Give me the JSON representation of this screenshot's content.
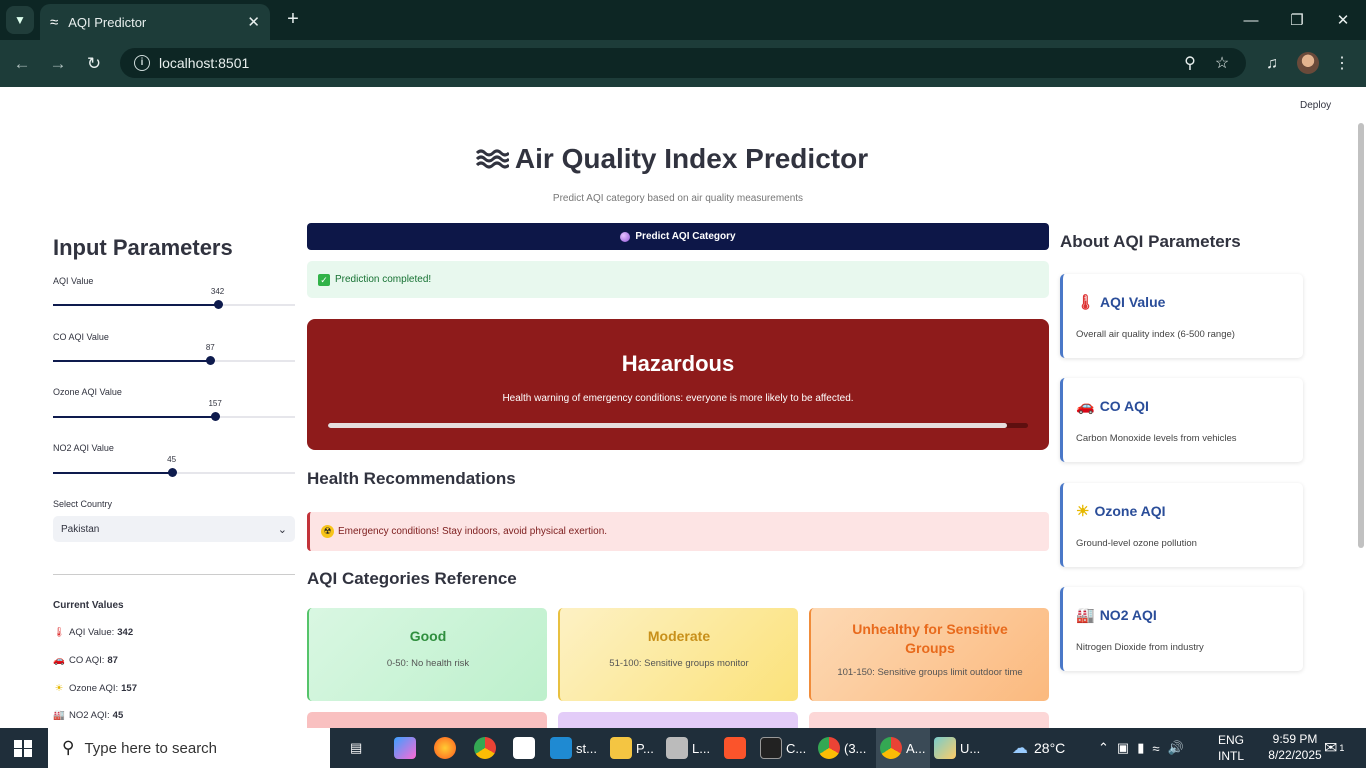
{
  "browser": {
    "tab_title": "AQI Predictor",
    "url": "localhost:8501"
  },
  "app": {
    "deploy_label": "Deploy",
    "title": "Air Quality Index Predictor",
    "title_icon": "wave-icon",
    "subtitle": "Predict AQI category based on air quality measurements"
  },
  "sidebar": {
    "title": "Input Parameters",
    "sliders": [
      {
        "label": "AQI Value",
        "value": "342",
        "fraction": 0.68
      },
      {
        "label": "CO AQI Value",
        "value": "87",
        "fraction": 0.65
      },
      {
        "label": "Ozone AQI Value",
        "value": "157",
        "fraction": 0.67
      },
      {
        "label": "NO2 AQI Value",
        "value": "45",
        "fraction": 0.49
      }
    ],
    "country_label": "Select Country",
    "country_value": "Pakistan",
    "current_title": "Current Values",
    "current": [
      {
        "label": "AQI Value:",
        "value": "342",
        "icon": "thermometer-icon"
      },
      {
        "label": "CO AQI:",
        "value": "87",
        "icon": "car-icon"
      },
      {
        "label": "Ozone AQI:",
        "value": "157",
        "icon": "sun-icon"
      },
      {
        "label": "NO2 AQI:",
        "value": "45",
        "icon": "factory-icon"
      }
    ]
  },
  "main": {
    "predict_button": "Predict AQI Category",
    "success_text": "Prediction completed!",
    "result": {
      "category": "Hazardous",
      "description": "Health warning of emergency conditions: everyone is more likely to be affected.",
      "progress": 0.97,
      "color": "#8e1b1b"
    },
    "health_title": "Health Recommendations",
    "health_alert": "Emergency conditions! Stay indoors, avoid physical exertion.",
    "reference_title": "AQI Categories Reference",
    "categories": [
      {
        "name": "Good",
        "range": "0-50: No health risk",
        "color": "#2f8f3e"
      },
      {
        "name": "Moderate",
        "range": "51-100: Sensitive groups monitor",
        "color": "#c8901a"
      },
      {
        "name": "Unhealthy for Sensitive Groups",
        "range": "101-150: Sensitive groups limit outdoor time",
        "color": "#e86a1c"
      }
    ]
  },
  "about": {
    "title": "About AQI Parameters",
    "cards": [
      {
        "title": "AQI Value",
        "desc": "Overall air quality index (6-500 range)",
        "icon": "thermometer-icon"
      },
      {
        "title": "CO AQI",
        "desc": "Carbon Monoxide levels from vehicles",
        "icon": "car-icon"
      },
      {
        "title": "Ozone AQI",
        "desc": "Ground-level ozone pollution",
        "icon": "sun-icon"
      },
      {
        "title": "NO2 AQI",
        "desc": "Nitrogen Dioxide from industry",
        "icon": "factory-icon"
      }
    ]
  },
  "taskbar": {
    "search_placeholder": "Type here to search",
    "apps": [
      {
        "label": "st..."
      },
      {
        "label": "P..."
      },
      {
        "label": "L..."
      },
      {
        "label": "C..."
      },
      {
        "label": "(3..."
      },
      {
        "label": "A..."
      },
      {
        "label": "U..."
      }
    ],
    "weather": "28°C",
    "language": "ENG",
    "layout": "INTL",
    "time": "9:59 PM",
    "date": "8/22/2025",
    "notification_count": "1"
  }
}
